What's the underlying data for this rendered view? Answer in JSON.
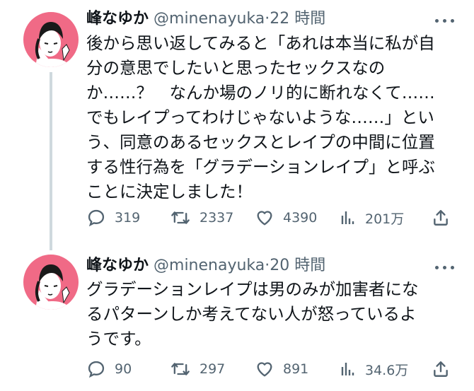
{
  "tweets": [
    {
      "author": "峰なゆか",
      "handle": "@minenayuka",
      "sep": "·",
      "time": "22 時間",
      "lines": [
        "後から思い返してみると「あれは本当に私が自",
        "分の意思でしたいと思ったセックスなの",
        "か……？　なんか場のノリ的に断れなくて……",
        "でもレイプってわけじゃないような……」とい",
        "う、同意のあるセックスとレイプの中間に位置",
        "する性行為を「グラデーションレイプ」と呼ぶ",
        "ことに決定しました！"
      ],
      "stats": {
        "replies": "319",
        "retweets": "2337",
        "likes": "4390",
        "views": "201万"
      }
    },
    {
      "author": "峰なゆか",
      "handle": "@minenayuka",
      "sep": "·",
      "time": "20 時間",
      "lines": [
        "グラデーションレイプは男のみが加害者にな",
        "るパターンしか考えてない人が怒っているよ",
        "うです。"
      ],
      "stats": {
        "replies": "90",
        "retweets": "297",
        "likes": "891",
        "views": "34.6万"
      }
    }
  ],
  "colors": {
    "avatar_bg": "#f06a86",
    "text": "#0f1419",
    "muted": "#536471",
    "thread_line": "#cfd9de"
  },
  "icons": [
    "more-icon",
    "reply-icon",
    "retweet-icon",
    "like-icon",
    "views-icon",
    "share-icon"
  ]
}
